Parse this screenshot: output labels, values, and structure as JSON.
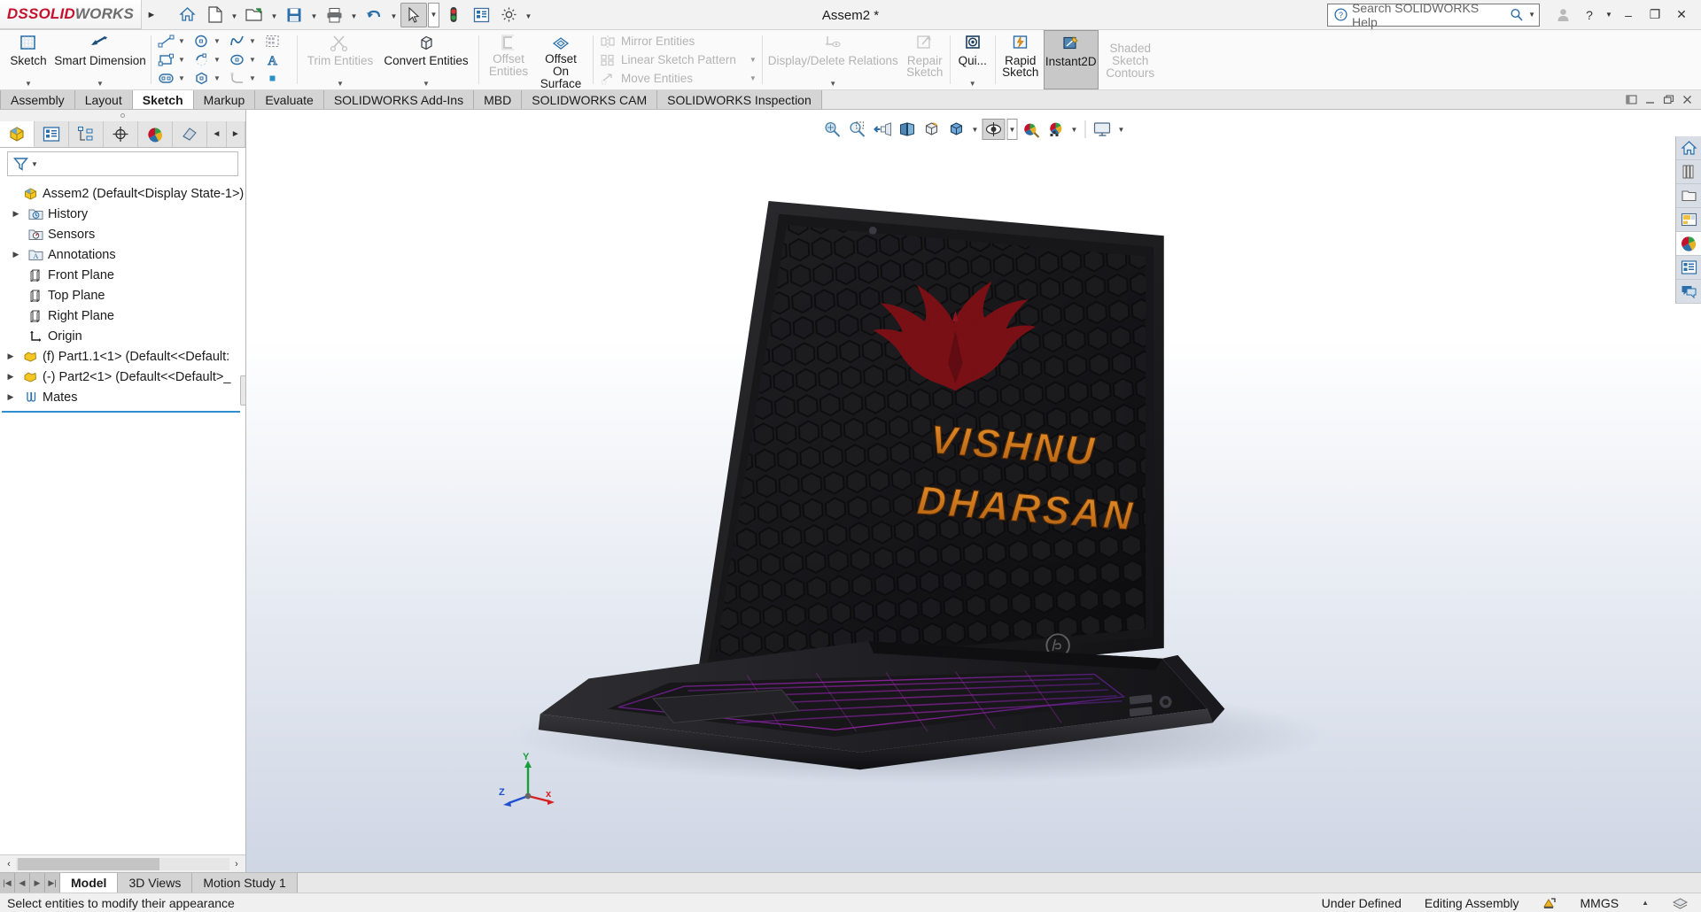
{
  "app": {
    "brand_ds": "DS",
    "brand_solid": "SOLID",
    "brand_works": "WORKS",
    "document_title": "Assem2 *"
  },
  "titlebar": {
    "quick_access": [
      {
        "name": "home-icon",
        "label": "Home"
      },
      {
        "name": "new-document-icon",
        "label": "New"
      },
      {
        "name": "open-folder-icon",
        "label": "Open"
      },
      {
        "name": "save-icon",
        "label": "Save"
      },
      {
        "name": "print-icon",
        "label": "Print"
      },
      {
        "name": "undo-icon",
        "label": "Undo"
      },
      {
        "name": "select-cursor-icon",
        "label": "Select"
      },
      {
        "name": "rebuild-icon",
        "label": "Rebuild"
      },
      {
        "name": "options-list-icon",
        "label": "File Properties"
      },
      {
        "name": "gear-icon",
        "label": "Options"
      }
    ],
    "search_placeholder": "Search SOLIDWORKS Help",
    "search_value": "",
    "profile_label": "Profile",
    "help_label": "?",
    "minimize_label": "–",
    "restore_label": "❐",
    "close_label": "✕"
  },
  "ribbon": {
    "sketch": {
      "label": "Sketch"
    },
    "smart_dimension": {
      "label": "Smart Dimension"
    },
    "entity_tools": [
      {
        "name": "line-tool",
        "glyph": "line"
      },
      {
        "name": "rectangle-tool",
        "glyph": "rect"
      },
      {
        "name": "slot-tool",
        "glyph": "slot"
      },
      {
        "name": "circle-tool",
        "glyph": "circle"
      },
      {
        "name": "arc-tool",
        "glyph": "arc"
      },
      {
        "name": "polygon-tool",
        "glyph": "polygon"
      },
      {
        "name": "spline-tool",
        "glyph": "spline"
      },
      {
        "name": "ellipse-tool",
        "glyph": "ellipse"
      },
      {
        "name": "fillet-tool",
        "glyph": "fillet"
      },
      {
        "name": "sketch-pattern-tool",
        "glyph": "pattern"
      },
      {
        "name": "text-tool",
        "glyph": "text"
      },
      {
        "name": "point-tool",
        "glyph": "point"
      }
    ],
    "trim_entities": {
      "label": "Trim Entities",
      "disabled": true
    },
    "convert_entities": {
      "label": "Convert Entities",
      "disabled": false
    },
    "offset_entities": {
      "label": "Offset Entities",
      "disabled": true
    },
    "offset_on_surface": {
      "label": "Offset On Surface",
      "disabled": false
    },
    "mirror_entities": {
      "label": "Mirror Entities",
      "disabled": true
    },
    "linear_sketch_pattern": {
      "label": "Linear Sketch Pattern",
      "disabled": true
    },
    "move_entities": {
      "label": "Move Entities",
      "disabled": true
    },
    "display_delete_relations": {
      "label": "Display/Delete Relations",
      "disabled": true
    },
    "repair_sketch": {
      "label": "Repair Sketch",
      "disabled": true
    },
    "quick_snaps": {
      "label": "Qui...",
      "disabled": false
    },
    "rapid_sketch": {
      "label": "Rapid Sketch",
      "disabled": false
    },
    "instant2d": {
      "label": "Instant2D",
      "active": true
    },
    "shaded_sketch_contours": {
      "label": "Shaded Sketch Contours",
      "disabled": true
    }
  },
  "command_tabs": {
    "items": [
      {
        "label": "Assembly",
        "active": false
      },
      {
        "label": "Layout",
        "active": false
      },
      {
        "label": "Sketch",
        "active": true
      },
      {
        "label": "Markup",
        "active": false
      },
      {
        "label": "Evaluate",
        "active": false
      },
      {
        "label": "SOLIDWORKS Add-Ins",
        "active": false
      },
      {
        "label": "MBD",
        "active": false
      },
      {
        "label": "SOLIDWORKS CAM",
        "active": false
      },
      {
        "label": "SOLIDWORKS Inspection",
        "active": false
      }
    ],
    "window_controls": [
      "restore-panel-icon",
      "minimize-window-icon",
      "restore-window-icon",
      "close-window-icon"
    ]
  },
  "feature_manager": {
    "tabs": [
      {
        "name": "feature-manager-tree-tab",
        "active": true
      },
      {
        "name": "property-manager-tab",
        "active": false
      },
      {
        "name": "configuration-manager-tab",
        "active": false
      },
      {
        "name": "dimxpert-manager-tab",
        "active": false
      },
      {
        "name": "display-manager-tab",
        "active": false
      },
      {
        "name": "render-manager-tab",
        "active": false
      }
    ],
    "nav_prev": "◄",
    "nav_next": "►",
    "filter_placeholder": "",
    "tree": [
      {
        "label": "Assem2  (Default<Display State-1>)",
        "icon": "assembly-icon",
        "indent": 0,
        "expandable": false
      },
      {
        "label": "History",
        "icon": "history-icon",
        "indent": 1,
        "expandable": true
      },
      {
        "label": "Sensors",
        "icon": "sensors-icon",
        "indent": 1,
        "expandable": false
      },
      {
        "label": "Annotations",
        "icon": "annotations-icon",
        "indent": 1,
        "expandable": true
      },
      {
        "label": "Front Plane",
        "icon": "plane-icon",
        "indent": 1,
        "expandable": false
      },
      {
        "label": "Top Plane",
        "icon": "plane-icon",
        "indent": 1,
        "expandable": false
      },
      {
        "label": "Right Plane",
        "icon": "plane-icon",
        "indent": 1,
        "expandable": false
      },
      {
        "label": "Origin",
        "icon": "origin-icon",
        "indent": 1,
        "expandable": false
      },
      {
        "label": "(f) Part1.1<1>  (Default<<Default:",
        "icon": "part-icon",
        "indent": 1,
        "expandable": true
      },
      {
        "label": "(-) Part2<1>  (Default<<Default>_",
        "icon": "part-icon",
        "indent": 1,
        "expandable": true
      },
      {
        "label": "Mates",
        "icon": "mates-icon",
        "indent": 1,
        "expandable": true
      }
    ]
  },
  "viewport": {
    "heads_up_toolbar": [
      {
        "name": "zoom-to-fit-icon",
        "dropdown": false
      },
      {
        "name": "zoom-to-area-icon",
        "dropdown": false
      },
      {
        "name": "previous-view-icon",
        "dropdown": false
      },
      {
        "name": "section-view-icon",
        "dropdown": false
      },
      {
        "name": "view-orientation-icon",
        "dropdown": false
      },
      {
        "name": "display-style-icon",
        "dropdown": true
      },
      {
        "name": "hide-show-items-icon",
        "dropdown": true,
        "selected": true
      },
      {
        "name": "edit-appearance-icon",
        "dropdown": false
      },
      {
        "name": "apply-scene-icon",
        "dropdown": true
      },
      {
        "name": "view-settings-icon",
        "dropdown": true
      }
    ],
    "triad": {
      "x_label": "x",
      "y_label": "Y",
      "z_label": "Z"
    },
    "model": {
      "screen_line1": "VISHNU",
      "screen_line2": "DHARSAN",
      "brand_mark": "hp-logo",
      "screen_text_color": "#d4821e",
      "chassis_color": "#1d1d1f",
      "keyboard_backlight_color": "#8a2be2",
      "emblem_color": "#8b1015"
    }
  },
  "right_dock": [
    {
      "name": "home-task-pane-icon"
    },
    {
      "name": "design-library-icon"
    },
    {
      "name": "file-explorer-icon"
    },
    {
      "name": "view-palette-icon"
    },
    {
      "name": "appearances-scenes-icon"
    },
    {
      "name": "custom-properties-icon"
    },
    {
      "name": "solidworks-forum-icon"
    }
  ],
  "bottom": {
    "nav_buttons": [
      "first-tab-icon",
      "previous-tab-icon",
      "next-tab-icon",
      "last-tab-icon"
    ],
    "tabs": [
      {
        "label": "Model",
        "active": true
      },
      {
        "label": "3D Views",
        "active": false
      },
      {
        "label": "Motion Study 1",
        "active": false
      }
    ],
    "scroll_left": "‹",
    "scroll_right": "›"
  },
  "statusbar": {
    "message": "Select entities to modify their appearance",
    "state": "Under Defined",
    "mode": "Editing Assembly",
    "units": "MMGS",
    "overlay_icon": "edit-assembly-icon",
    "caret": "▲",
    "tail_icon": "layers-icon"
  }
}
